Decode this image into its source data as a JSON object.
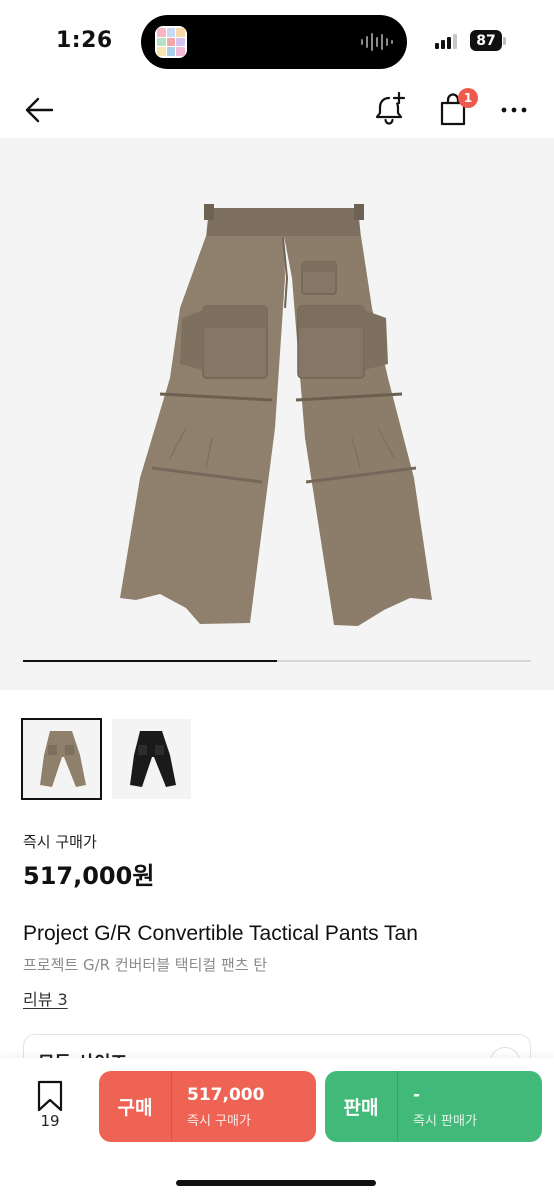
{
  "status_bar": {
    "time": "1:26",
    "battery": "87",
    "icons": [
      "app-thumbnail-icon",
      "audio-wave-icon",
      "cellular-signal-icon",
      "battery-icon"
    ]
  },
  "nav": {
    "icons": [
      "back-arrow-icon",
      "bell-plus-icon",
      "shopping-bag-icon",
      "more-dots-icon"
    ],
    "bag_badge": "1"
  },
  "gallery": {
    "progress": 0.5,
    "thumbnails": [
      {
        "name": "Tan",
        "selected": true,
        "color": "#8f806c"
      },
      {
        "name": "Black",
        "selected": false,
        "color": "#1a1a1a"
      }
    ]
  },
  "product": {
    "price_label": "즉시 구매가",
    "price": "517,000원",
    "name_en": "Project G/R Convertible Tactical Pants Tan",
    "name_ko": "프로젝트 G/R 컨버터블 택티컬 팬츠 탄",
    "review_link": "리뷰 3"
  },
  "size_selector": {
    "label": "모든 사이즈"
  },
  "bottom_bar": {
    "bookmark_count": "19",
    "buy": {
      "label": "구매",
      "price": "517,000",
      "sub": "즉시 구매가",
      "color": "#ef6354"
    },
    "sell": {
      "label": "판매",
      "price": "-",
      "sub": "즉시 판매가",
      "color": "#41b979"
    }
  }
}
